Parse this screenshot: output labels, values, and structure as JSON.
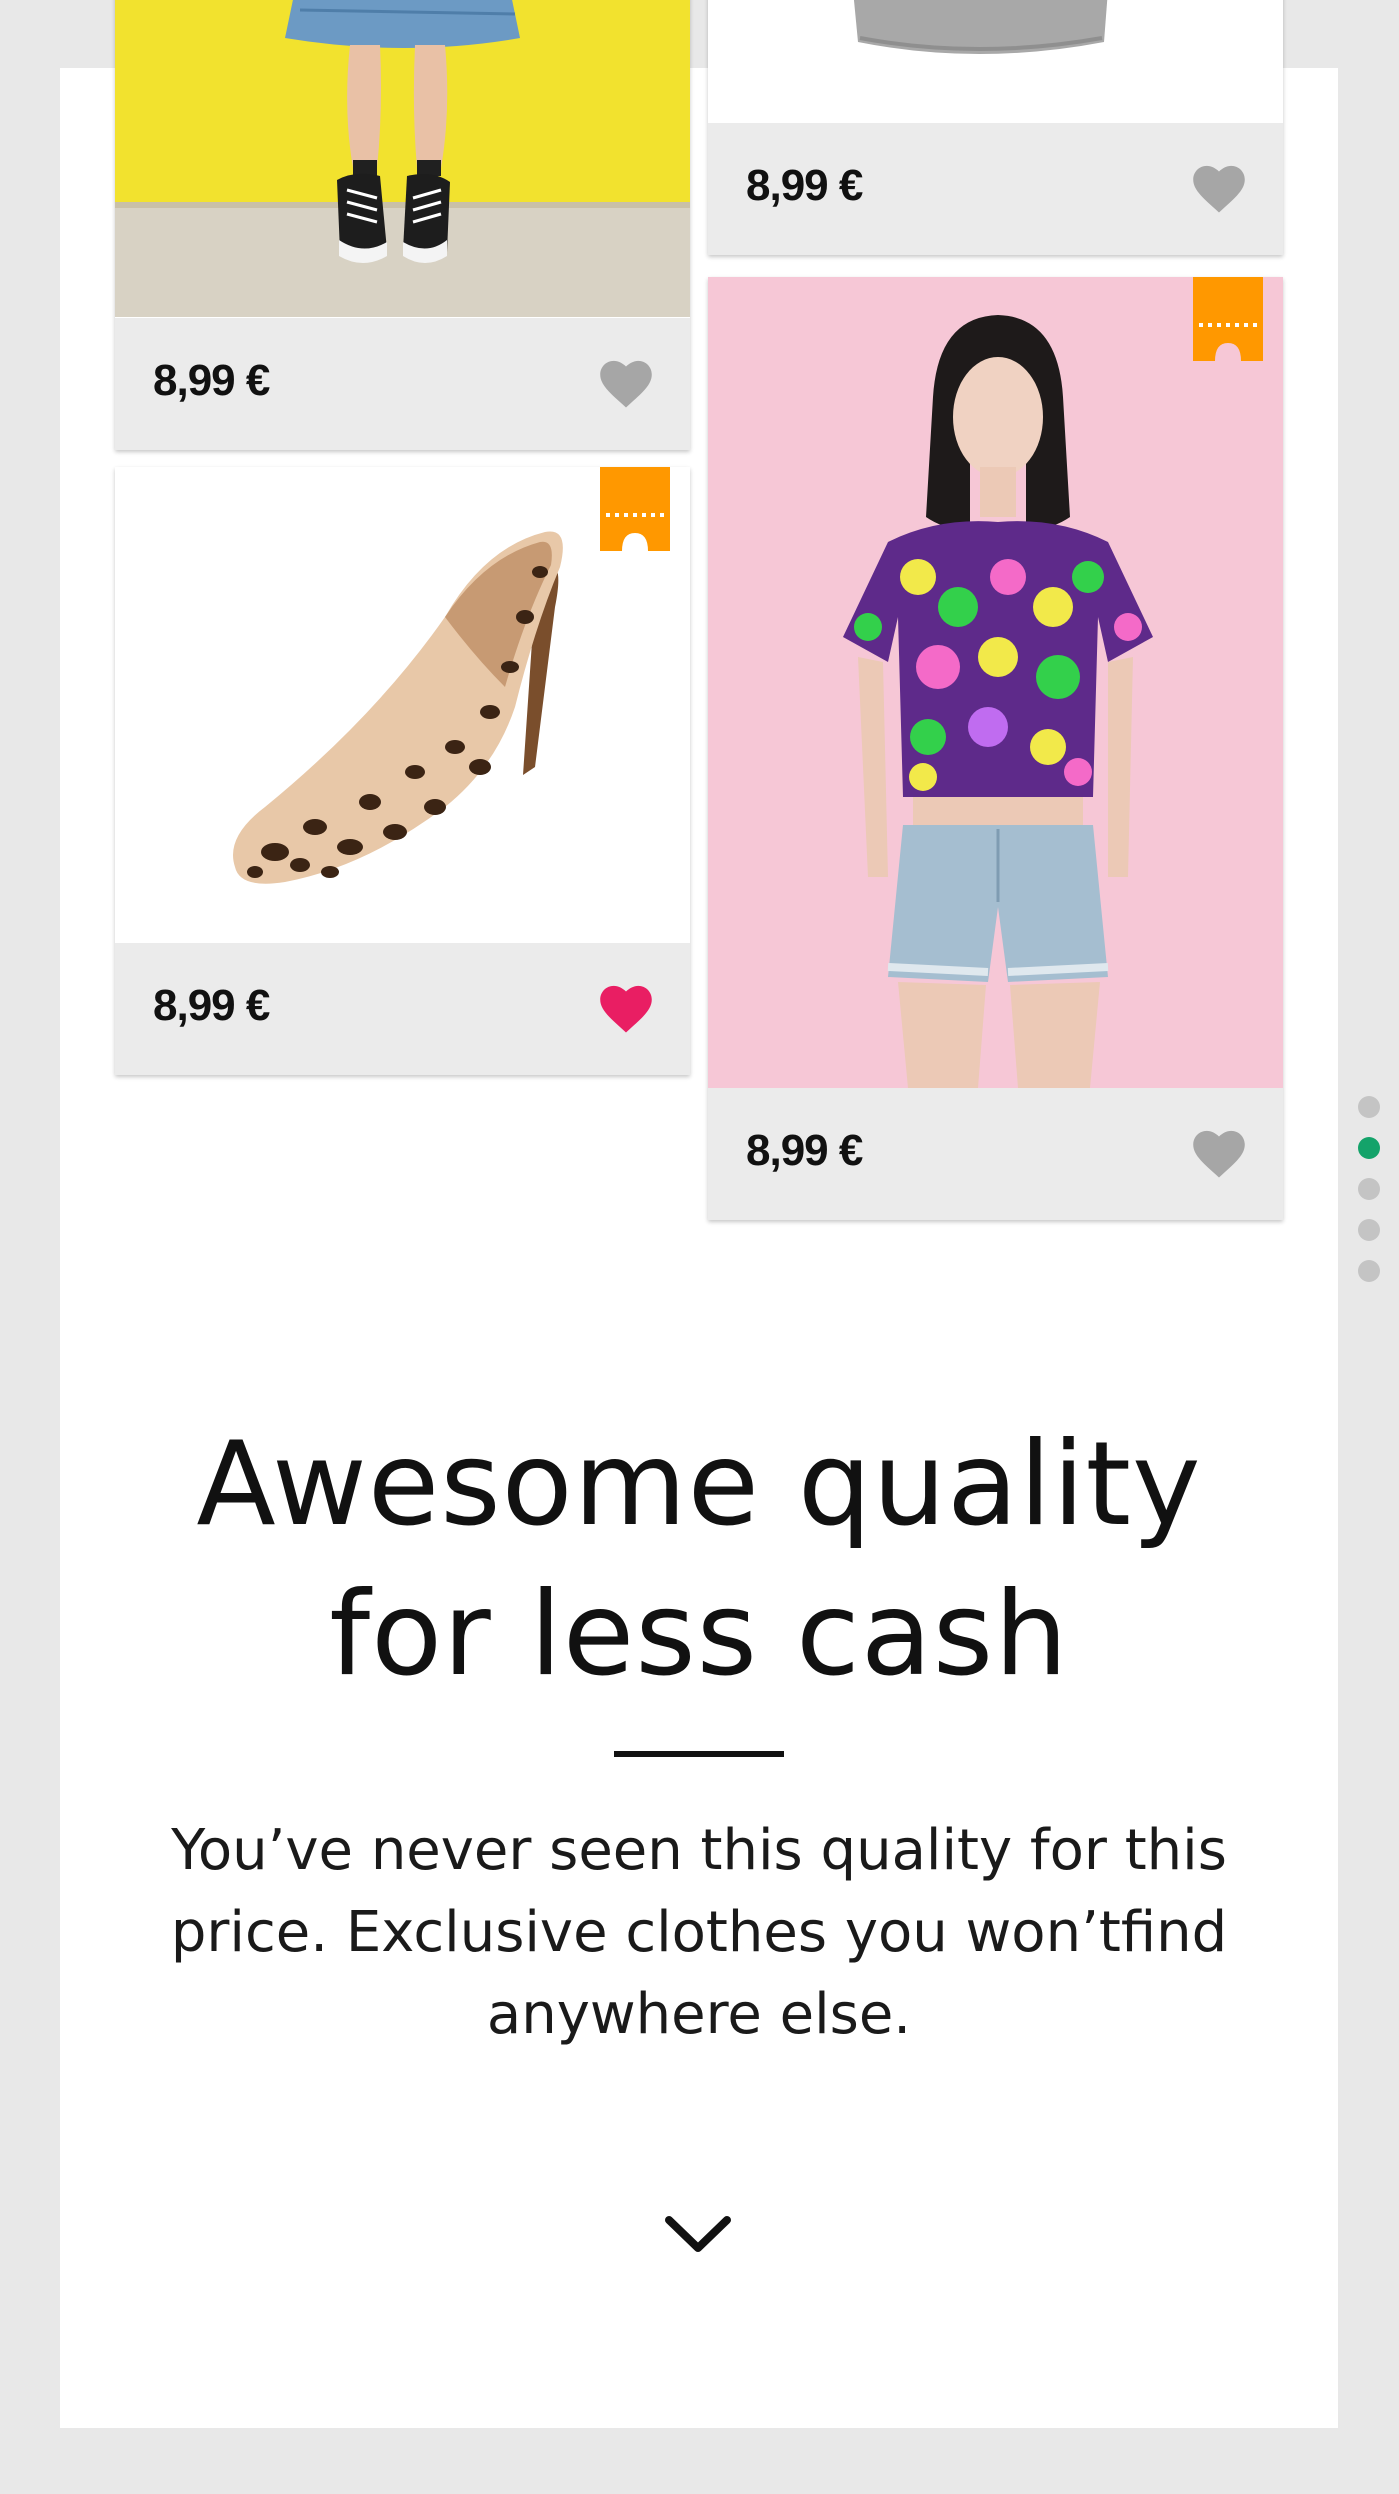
{
  "colors": {
    "accent_green": "#14a36a",
    "heart_inactive": "#a6a6a6",
    "heart_active": "#e91e63",
    "badge_orange": "#ff9800",
    "panel_background": "#e8e8e8"
  },
  "products": [
    {
      "price": "8,99 €",
      "favorited": false,
      "has_badge": false,
      "image": "person-denim-dress-converse-sneakers-yellow-wall"
    },
    {
      "price": "8,99 €",
      "favorited": false,
      "has_badge": false,
      "image": "grey-top-white-background"
    },
    {
      "price": "8,99 €",
      "favorited": true,
      "has_badge": true,
      "badge_icon": "ticket-icon",
      "image": "leopard-print-high-heel-pump"
    },
    {
      "price": "8,99 €",
      "favorited": false,
      "has_badge": true,
      "badge_icon": "ticket-icon",
      "image": "woman-floral-crop-top-denim-shorts-pink-background"
    }
  ],
  "hero": {
    "headline_line1": "Awesome quality",
    "headline_line2": "for less cash",
    "body_line1": "You’ve never seen this quality for this",
    "body_line2": "price. Exclusive clothes you won’tfind",
    "body_line3": "anywhere else."
  },
  "pagination": {
    "total_pages": 5,
    "active_index": 1
  },
  "icons": {
    "scroll": "chevron-down-icon",
    "favorite": "heart-icon",
    "badge": "ticket-icon"
  }
}
